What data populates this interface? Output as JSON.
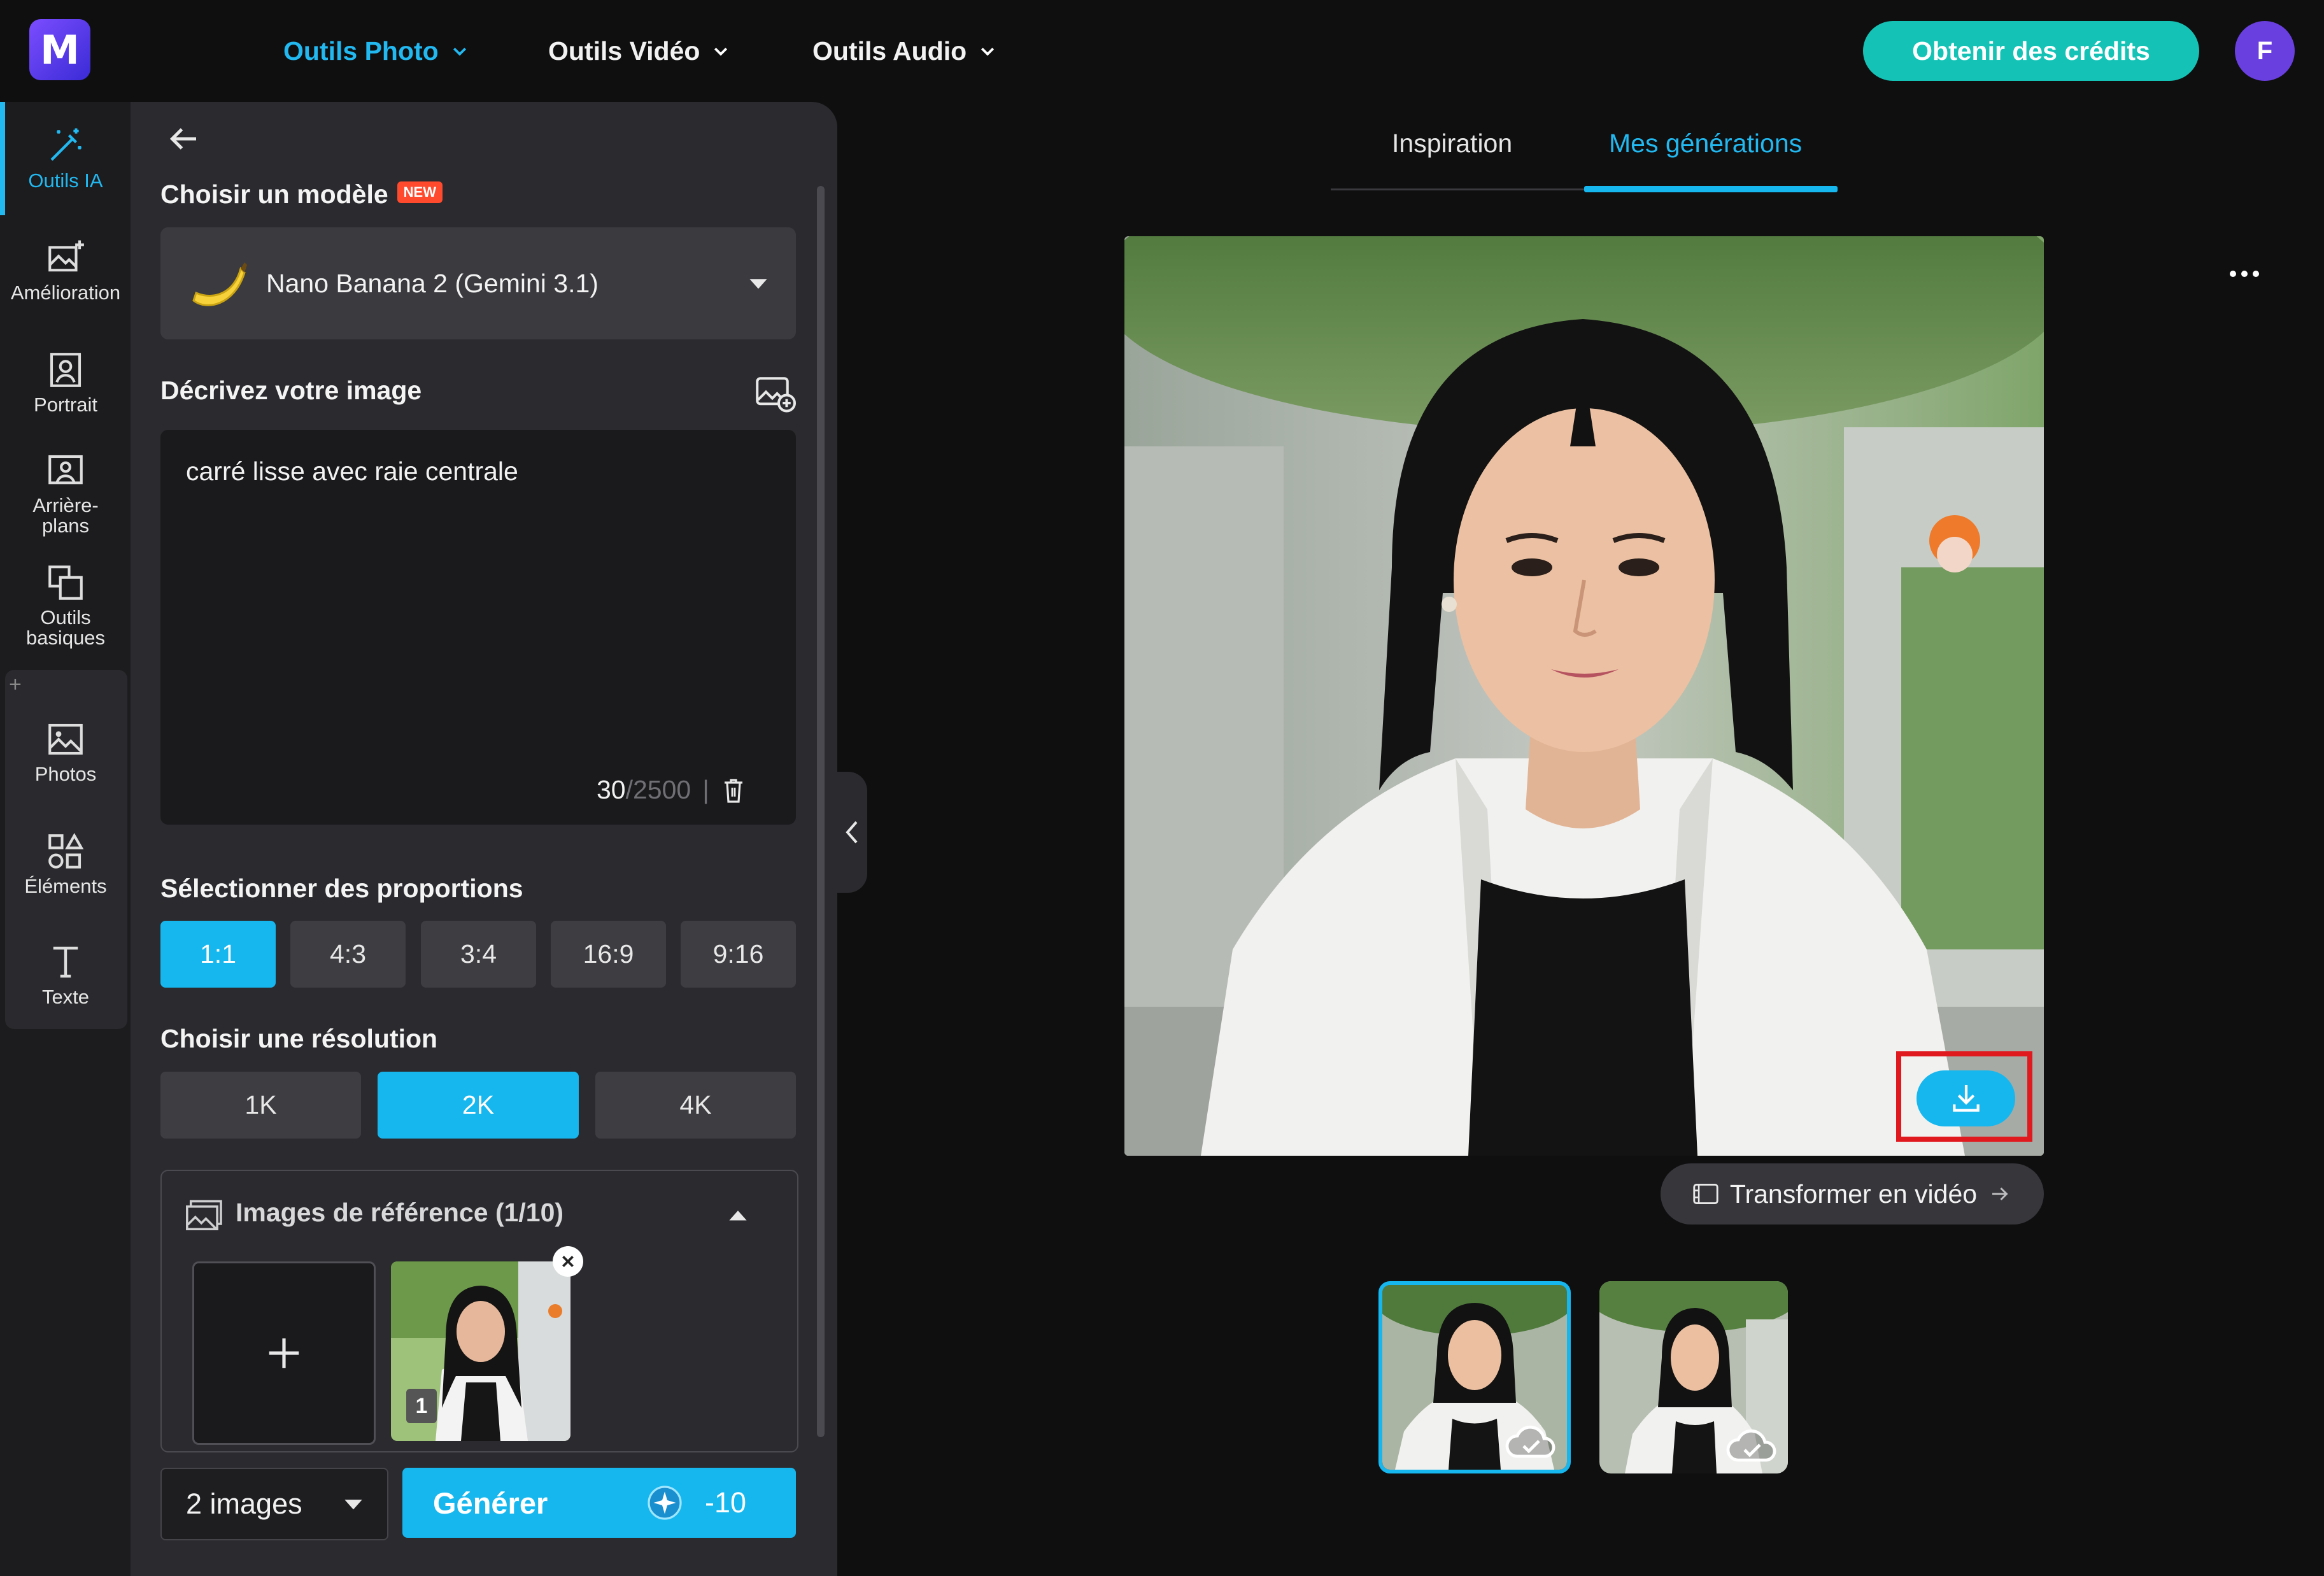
{
  "header": {
    "logo_letter": "M",
    "nav": [
      {
        "label": "Outils Photo",
        "active": true
      },
      {
        "label": "Outils Vidéo",
        "active": false
      },
      {
        "label": "Outils Audio",
        "active": false
      }
    ],
    "credits_button": "Obtenir des crédits",
    "avatar_letter": "F"
  },
  "rail": {
    "items": [
      {
        "label": "Outils IA",
        "icon": "magic-wand-icon",
        "active": true
      },
      {
        "label": "Amélioration",
        "icon": "image-sparkle-icon"
      },
      {
        "label": "Portrait",
        "icon": "portrait-icon"
      },
      {
        "label": "Arrière-plans",
        "icon": "background-icon"
      },
      {
        "label": "Outils basiques",
        "icon": "crop-icon"
      },
      {
        "label": "Photos",
        "icon": "photos-icon"
      },
      {
        "label": "Éléments",
        "icon": "shapes-icon"
      },
      {
        "label": "Texte",
        "icon": "text-icon"
      }
    ]
  },
  "panel": {
    "model_title": "Choisir un modèle",
    "new_badge": "NEW",
    "model_name": "Nano Banana 2 (Gemini 3.1)",
    "describe_title": "Décrivez votre image",
    "prompt_text": "carré lisse avec raie centrale",
    "char_count": "30",
    "char_max": "/2500",
    "char_sep": "|",
    "proportions_title": "Sélectionner des proportions",
    "proportions": [
      "1:1",
      "4:3",
      "3:4",
      "16:9",
      "9:16"
    ],
    "proportion_selected": "1:1",
    "resolution_title": "Choisir une résolution",
    "resolutions": [
      "1K",
      "2K",
      "4K"
    ],
    "resolution_selected": "2K",
    "reference_title": "Images de référence (1/10)",
    "reference_index": "1",
    "quantity": "2 images",
    "generate_label": "Générer",
    "generate_cost": "-10"
  },
  "main": {
    "tabs": [
      {
        "label": "Inspiration",
        "active": false
      },
      {
        "label": "Mes générations",
        "active": true
      }
    ],
    "to_video_label": "Transformer en vidéo",
    "selected_thumbnail": 1
  },
  "colors": {
    "accent": "#16b7ee",
    "credits": "#14c3b6",
    "highlight": "#e0191f",
    "background": "#0f0f10",
    "panel": "#2b2b2f"
  }
}
